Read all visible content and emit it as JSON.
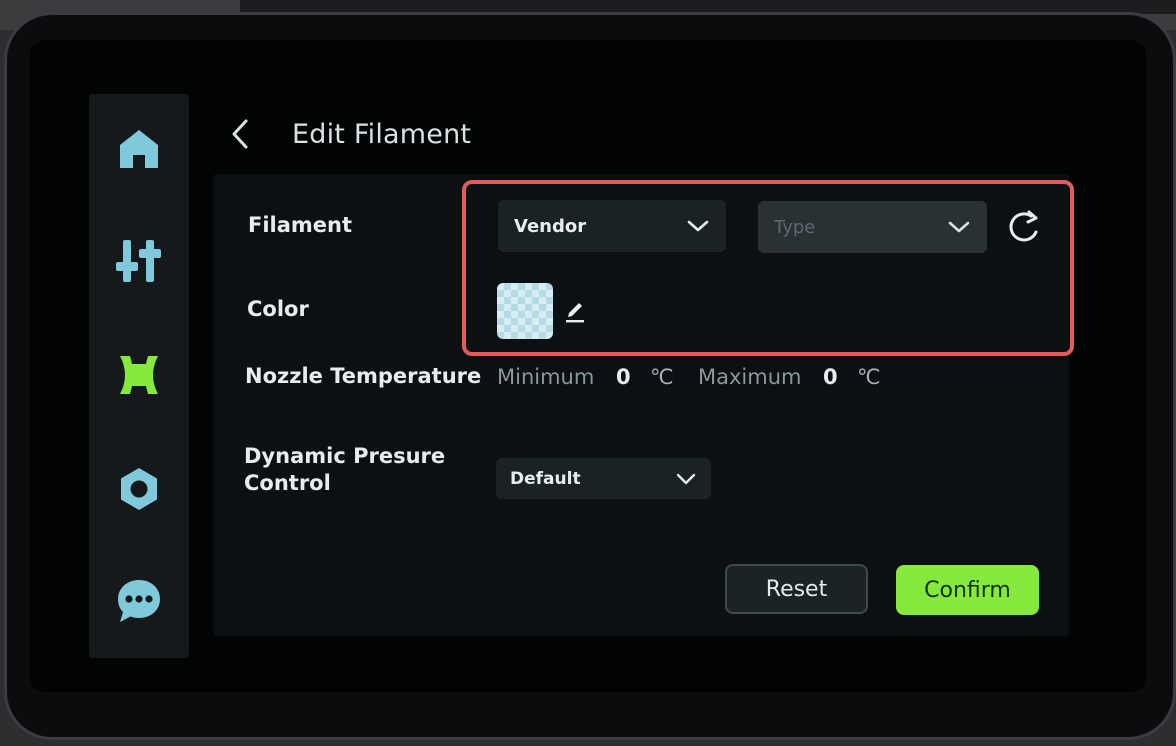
{
  "header": {
    "title": "Edit Filament"
  },
  "sidebar": {
    "items": [
      {
        "icon": "home-icon"
      },
      {
        "icon": "controls-icon"
      },
      {
        "icon": "filament-spool-icon"
      },
      {
        "icon": "nut-icon"
      },
      {
        "icon": "chat-icon"
      }
    ],
    "active_index": 2,
    "accent_color": "#86ea3e",
    "icon_color": "#7fc9da"
  },
  "form": {
    "filament_label": "Filament",
    "vendor_value": "Vendor",
    "type_placeholder": "Type",
    "color_label": "Color",
    "nozzle_label": "Nozzle Temperature",
    "min_label": "Minimum",
    "min_value": "0",
    "max_label": "Maximum",
    "max_value": "0",
    "temp_unit": "℃",
    "dpc_label_line1": "Dynamic Presure",
    "dpc_label_line2": "Control",
    "dpc_value": "Default"
  },
  "actions": {
    "reset_label": "Reset",
    "confirm_label": "Confirm"
  },
  "colors": {
    "highlight": "#e35b5b",
    "confirm": "#86ea3e",
    "swatch": "transparent-checker"
  }
}
